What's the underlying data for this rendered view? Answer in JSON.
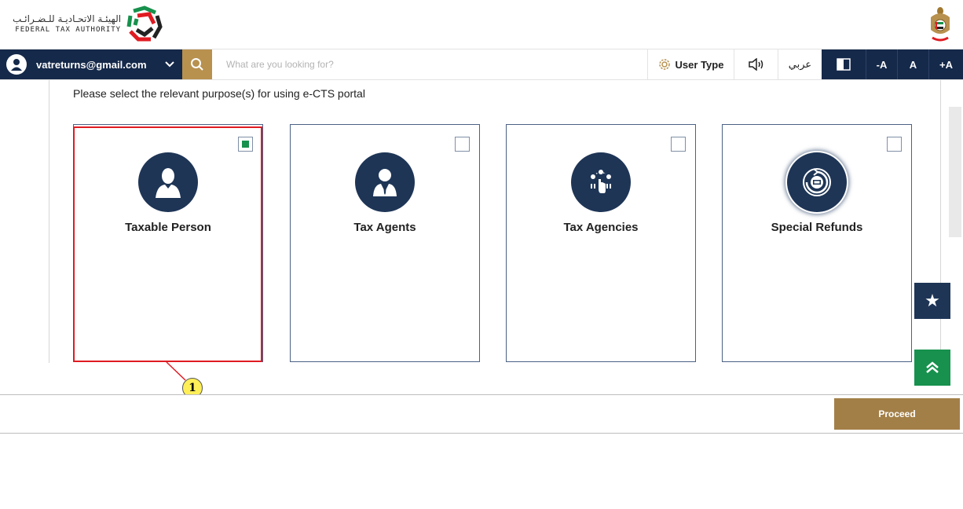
{
  "header": {
    "logo_arabic": "الهيئـة الاتحـاديـة للـضـرائـب",
    "logo_english": "FEDERAL TAX AUTHORITY",
    "emblem_icon": "uae-emblem-icon"
  },
  "toolbar": {
    "user_email": "vatreturns@gmail.com",
    "search_placeholder": "What are you looking for?",
    "user_type_label": "User Type",
    "arabic_label": "عربي",
    "font_decrease": "-A",
    "font_normal": "A",
    "font_increase": "+A"
  },
  "main": {
    "instruction": "Please select the relevant purpose(s) for using e-CTS portal",
    "cards": [
      {
        "label": "Taxable Person",
        "icon": "person-icon",
        "checked": true
      },
      {
        "label": "Tax Agents",
        "icon": "agent-icon",
        "checked": false
      },
      {
        "label": "Tax Agencies",
        "icon": "agencies-icon",
        "checked": false
      },
      {
        "label": "Special Refunds",
        "icon": "refund-icon",
        "checked": false
      }
    ],
    "callout_number": "1"
  },
  "footer": {
    "proceed_label": "Proceed"
  },
  "colors": {
    "navy": "#15294a",
    "gold": "#b8914f",
    "green": "#17914d",
    "highlight_red": "#e01b22"
  }
}
